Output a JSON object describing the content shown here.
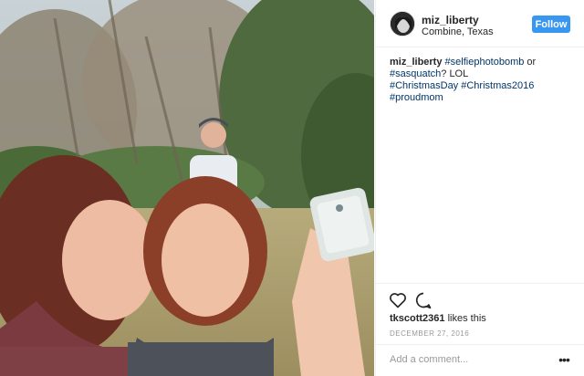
{
  "post": {
    "username": "miz_liberty",
    "location": "Combine, Texas",
    "follow_label": "Follow",
    "caption": {
      "username": "miz_liberty",
      "tags": [
        "#selfiephotobomb",
        "#sasquatch",
        "#ChristmasDay",
        "#Christmas2016",
        "#proudmom"
      ],
      "text_or": " or ",
      "text_lol": "? LOL",
      "space": " "
    },
    "liked_by": "tkscott2361",
    "likes_text": " likes this",
    "date": "DECEMBER 27, 2016",
    "comment_placeholder": "Add a comment...",
    "more_glyph": "•••"
  },
  "colors": {
    "accent": "#3897f0",
    "hashtag": "#003569",
    "muted": "#999999",
    "text": "#262626"
  },
  "icons": [
    "heart-icon",
    "comment-icon",
    "more-options-icon"
  ]
}
